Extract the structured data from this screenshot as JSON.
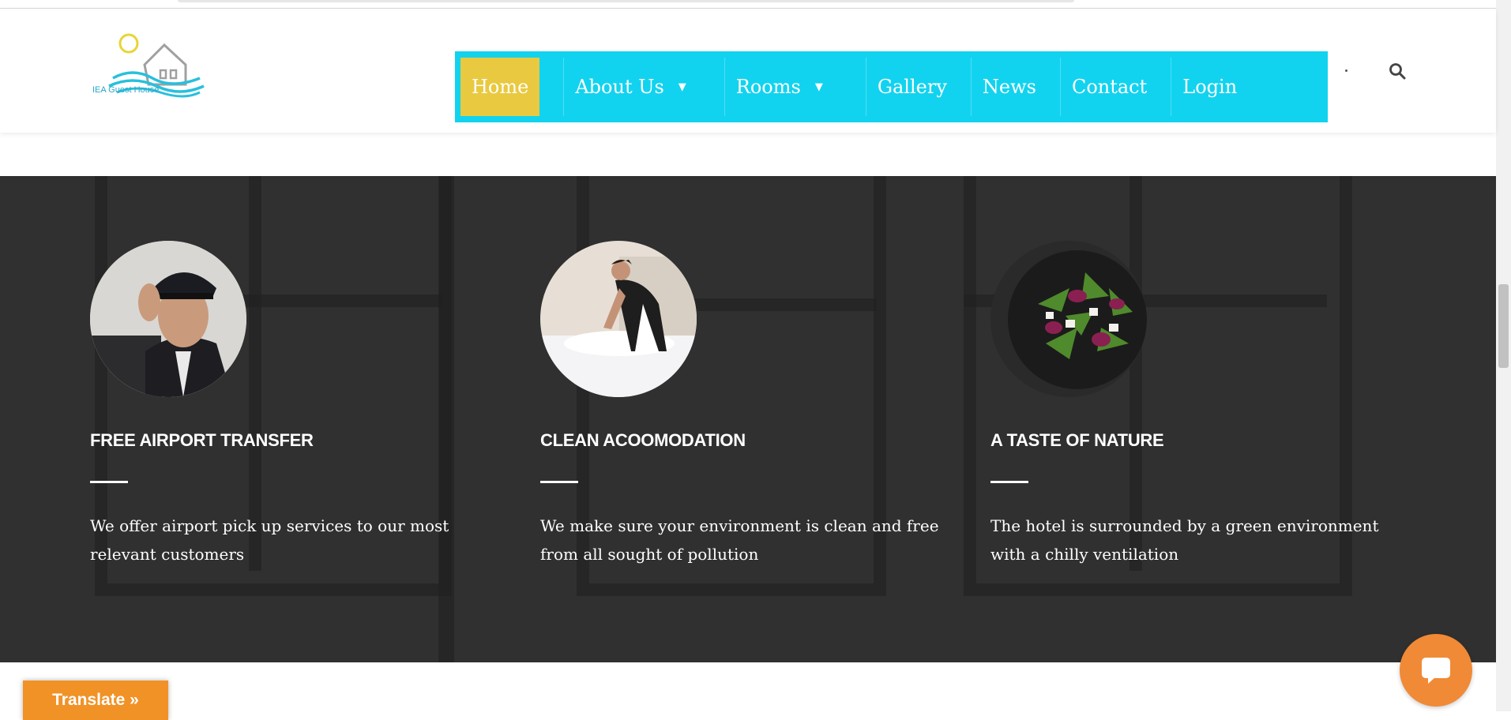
{
  "brand": {
    "logo_text": "IEA Guest House"
  },
  "nav": {
    "items": [
      {
        "label": "Home"
      },
      {
        "label": "About Us"
      },
      {
        "label": "Rooms"
      },
      {
        "label": "Gallery"
      },
      {
        "label": "News"
      },
      {
        "label": "Contact"
      },
      {
        "label": "Login"
      }
    ],
    "caret": "▼"
  },
  "features": [
    {
      "title": "FREE AIRPORT TRANSFER",
      "text": "We offer airport pick up services to our most relevant customers"
    },
    {
      "title": "CLEAN ACOOMODATION",
      "text": "We make sure your environment is clean and free from all sought of pollution"
    },
    {
      "title": "A TASTE OF NATURE",
      "text": "The hotel is surrounded by a green environment with a chilly ventilation"
    }
  ],
  "widgets": {
    "translate_label": "Translate »"
  },
  "colors": {
    "nav_bg": "#12d3ef",
    "active_bg": "#e9c93f",
    "translate_bg": "#f19227",
    "chat_bg": "#f08a36"
  }
}
